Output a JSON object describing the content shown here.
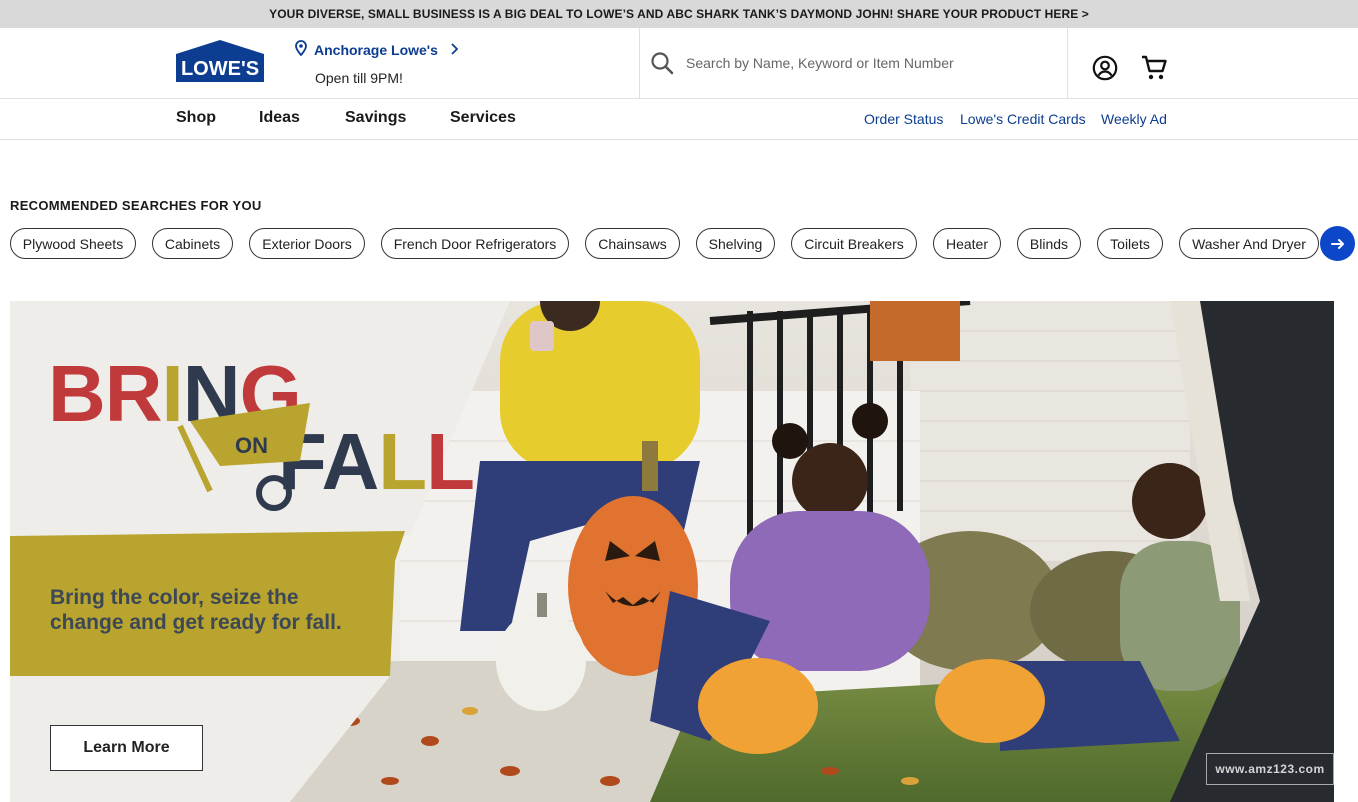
{
  "promo": {
    "text": "YOUR DIVERSE, SMALL BUSINESS IS A BIG DEAL TO LOWE’S AND ABC SHARK TANK’S DAYMOND JOHN! SHARE YOUR PRODUCT HERE >"
  },
  "header": {
    "logo_text": "LOWE'S",
    "store": {
      "name": "Anchorage Lowe's",
      "hours": "Open till 9PM!"
    },
    "search": {
      "placeholder": "Search by Name, Keyword or Item Number"
    },
    "icons": {
      "location": "map-pin-icon",
      "chevron": "chevron-right-icon",
      "search": "search-icon",
      "account": "account-icon",
      "cart": "cart-icon"
    }
  },
  "nav": {
    "items": [
      "Shop",
      "Ideas",
      "Savings",
      "Services"
    ],
    "links": [
      "Order Status",
      "Lowe's Credit Cards",
      "Weekly Ad"
    ]
  },
  "recommended": {
    "title": "RECOMMENDED SEARCHES FOR YOU",
    "items": [
      "Plywood Sheets",
      "Cabinets",
      "Exterior Doors",
      "French Door Refrigerators",
      "Chainsaws",
      "Shelving",
      "Circuit Breakers",
      "Heater",
      "Blinds",
      "Toilets",
      "Washer And Dryer"
    ]
  },
  "hero": {
    "logo_words": [
      "BRING",
      "ON",
      "FALL"
    ],
    "tagline_1": "Bring the color, seize the",
    "tagline_2": "change and get ready for fall.",
    "cta": "Learn More",
    "watermark": "www.amz123.com"
  },
  "colors": {
    "brand_blue": "#0c3d91",
    "button_blue": "#0d47c9",
    "fall_red": "#c0393b",
    "fall_gold": "#b8a42e",
    "fall_navy": "#2f3a4e"
  }
}
